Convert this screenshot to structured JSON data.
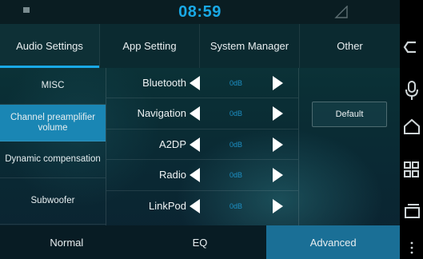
{
  "status_bar": {
    "time": "08:59",
    "left_icon": "notification-dot-icon",
    "right_icon": "signal-icon"
  },
  "tabs": [
    {
      "label": "Audio Settings",
      "active": true
    },
    {
      "label": "App Setting",
      "active": false
    },
    {
      "label": "System Manager",
      "active": false
    },
    {
      "label": "Other",
      "active": false
    }
  ],
  "sidebar": {
    "items": [
      {
        "label": "MISC",
        "active": false
      },
      {
        "label": "Channel preamplifier volume",
        "active": true
      },
      {
        "label": "Dynamic compensation",
        "active": false
      },
      {
        "label": "Subwoofer",
        "active": false
      }
    ]
  },
  "channels": [
    {
      "label": "Bluetooth",
      "value": "0dB"
    },
    {
      "label": "Navigation",
      "value": "0dB"
    },
    {
      "label": "A2DP",
      "value": "0dB"
    },
    {
      "label": "Radio",
      "value": "0dB"
    },
    {
      "label": "LinkPod",
      "value": "0dB"
    }
  ],
  "default_button": {
    "label": "Default"
  },
  "bottom_tabs": [
    {
      "label": "Normal",
      "active": false
    },
    {
      "label": "EQ",
      "active": false
    },
    {
      "label": "Advanced",
      "active": true
    }
  ],
  "navbar": {
    "icons": [
      "back-icon",
      "microphone-icon",
      "home-icon",
      "apps-icon",
      "recents-icon"
    ]
  },
  "colors": {
    "accent": "#19a9e6",
    "active_item": "#1a86b4",
    "active_bottom": "#1a6f96"
  }
}
